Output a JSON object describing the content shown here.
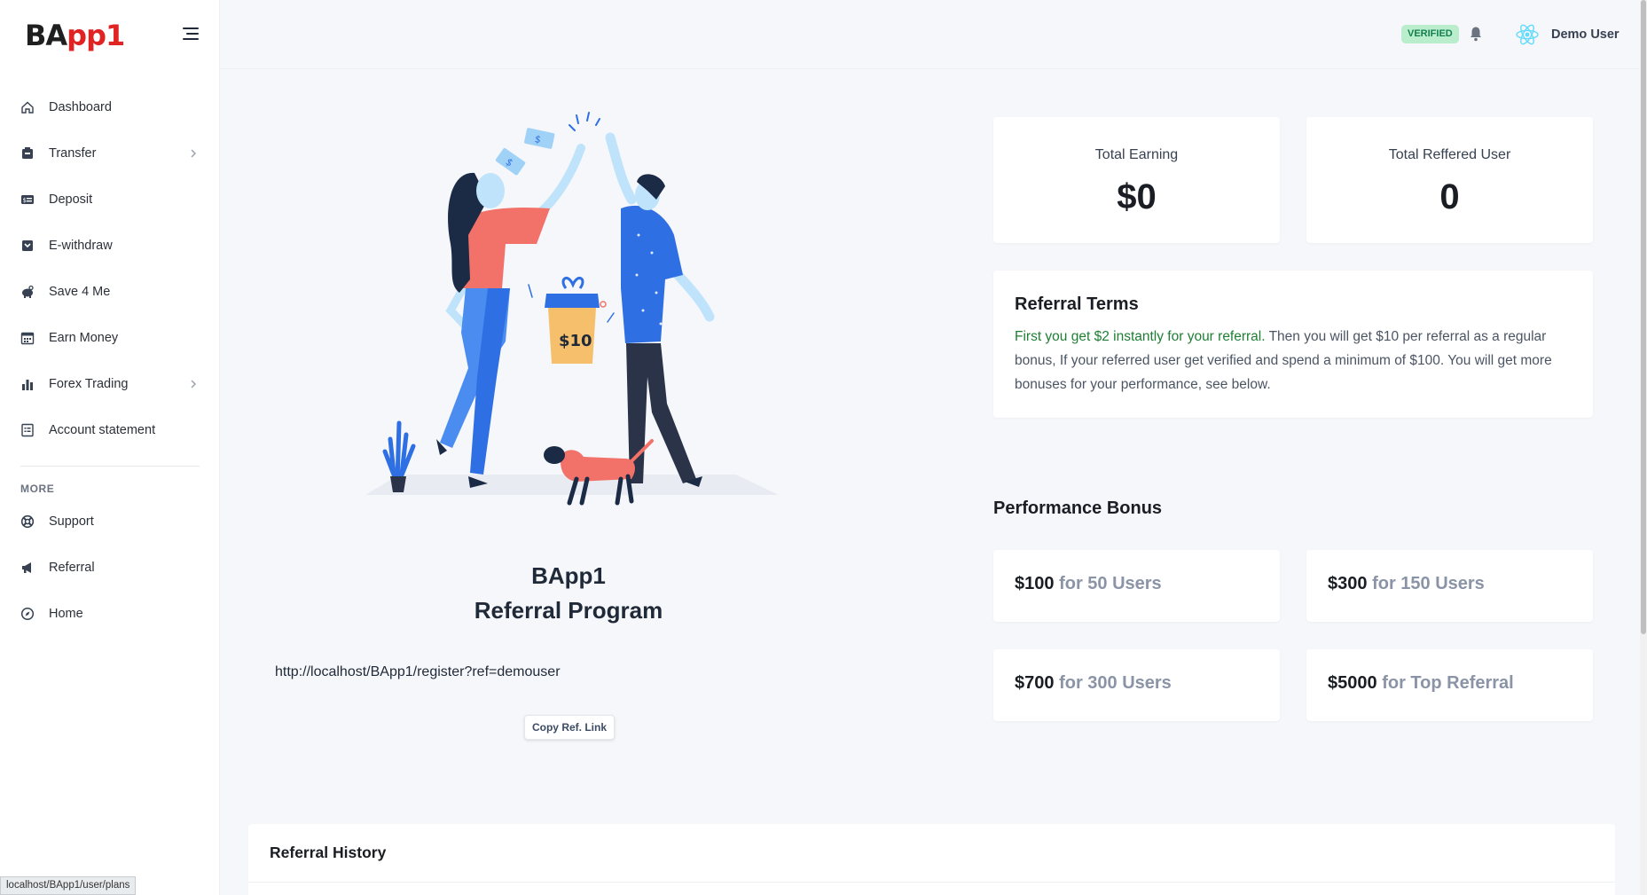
{
  "brand": {
    "part1": "BA",
    "part2": "pp1",
    "accent": "#e02424"
  },
  "sidebar": {
    "items": [
      {
        "label": "Dashboard",
        "icon": "home-icon"
      },
      {
        "label": "Transfer",
        "icon": "transfer-icon",
        "has_submenu": true
      },
      {
        "label": "Deposit",
        "icon": "deposit-icon"
      },
      {
        "label": "E-withdraw",
        "icon": "withdraw-icon"
      },
      {
        "label": "Save 4 Me",
        "icon": "piggy-icon"
      },
      {
        "label": "Earn Money",
        "icon": "calendar-icon"
      },
      {
        "label": "Forex Trading",
        "icon": "chart-icon",
        "has_submenu": true
      },
      {
        "label": "Account statement",
        "icon": "statement-icon"
      }
    ],
    "more_heading": "MORE",
    "more_items": [
      {
        "label": "Support",
        "icon": "lifebuoy-icon"
      },
      {
        "label": "Referral",
        "icon": "megaphone-icon"
      },
      {
        "label": "Home",
        "icon": "compass-icon"
      }
    ]
  },
  "header": {
    "verified_badge": "VERIFIED",
    "user_name": "Demo User"
  },
  "hero": {
    "title_line1": "BApp1",
    "title_line2": "Referral Program",
    "gift_label": "$10",
    "ref_link": "http://localhost/BApp1/register?ref=demouser",
    "copy_button": "Copy Ref. Link"
  },
  "stats": {
    "total_earning_label": "Total Earning",
    "total_earning_value": "$0",
    "total_referred_label": "Total Reffered User",
    "total_referred_value": "0"
  },
  "terms": {
    "title": "Referral Terms",
    "highlight": "First you get $2 instantly for your referral.",
    "body": " Then you will get $10 per referral as a regular bonus, If your referred user get verified and spend a minimum of $100. You will get more bonuses for your performance, see below."
  },
  "performance": {
    "title": "Performance Bonus",
    "bonuses": [
      {
        "amount": "$100",
        "desc": "for 50 Users"
      },
      {
        "amount": "$300",
        "desc": "for 150 Users"
      },
      {
        "amount": "$700",
        "desc": "for 300 Users"
      },
      {
        "amount": "$5000",
        "desc": "for Top Referral"
      }
    ]
  },
  "history": {
    "title": "Referral History"
  },
  "status_bar": "localhost/BApp1/user/plans"
}
